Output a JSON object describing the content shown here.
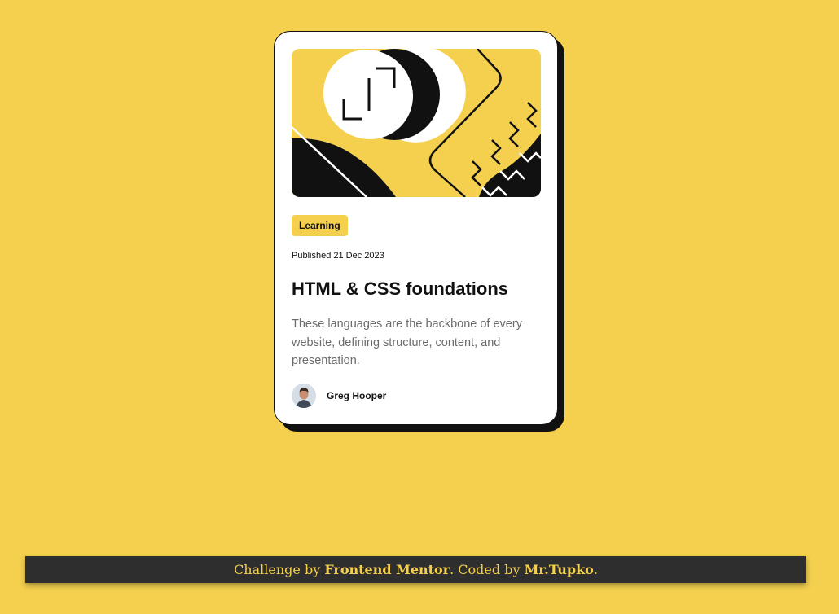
{
  "card": {
    "image_alt": "illustration-article",
    "tag": "Learning",
    "published": "Published 21 Dec 2023",
    "title": "HTML & CSS foundations",
    "description": "These languages are the backbone of every website, defining structure, content, and presentation.",
    "author": {
      "name": "Greg Hooper",
      "avatar_icon": "user-avatar"
    }
  },
  "footer": {
    "prefix": "Challenge by ",
    "link1": "Frontend Mentor",
    "middle": ". Coded by ",
    "link2": "Mr.Tupko",
    "suffix": "."
  },
  "colors": {
    "background": "#F4D04E",
    "card": "#FFFFFF",
    "ink": "#111111",
    "muted": "#6B6B6B",
    "footer_bg": "#2E2E2E"
  }
}
